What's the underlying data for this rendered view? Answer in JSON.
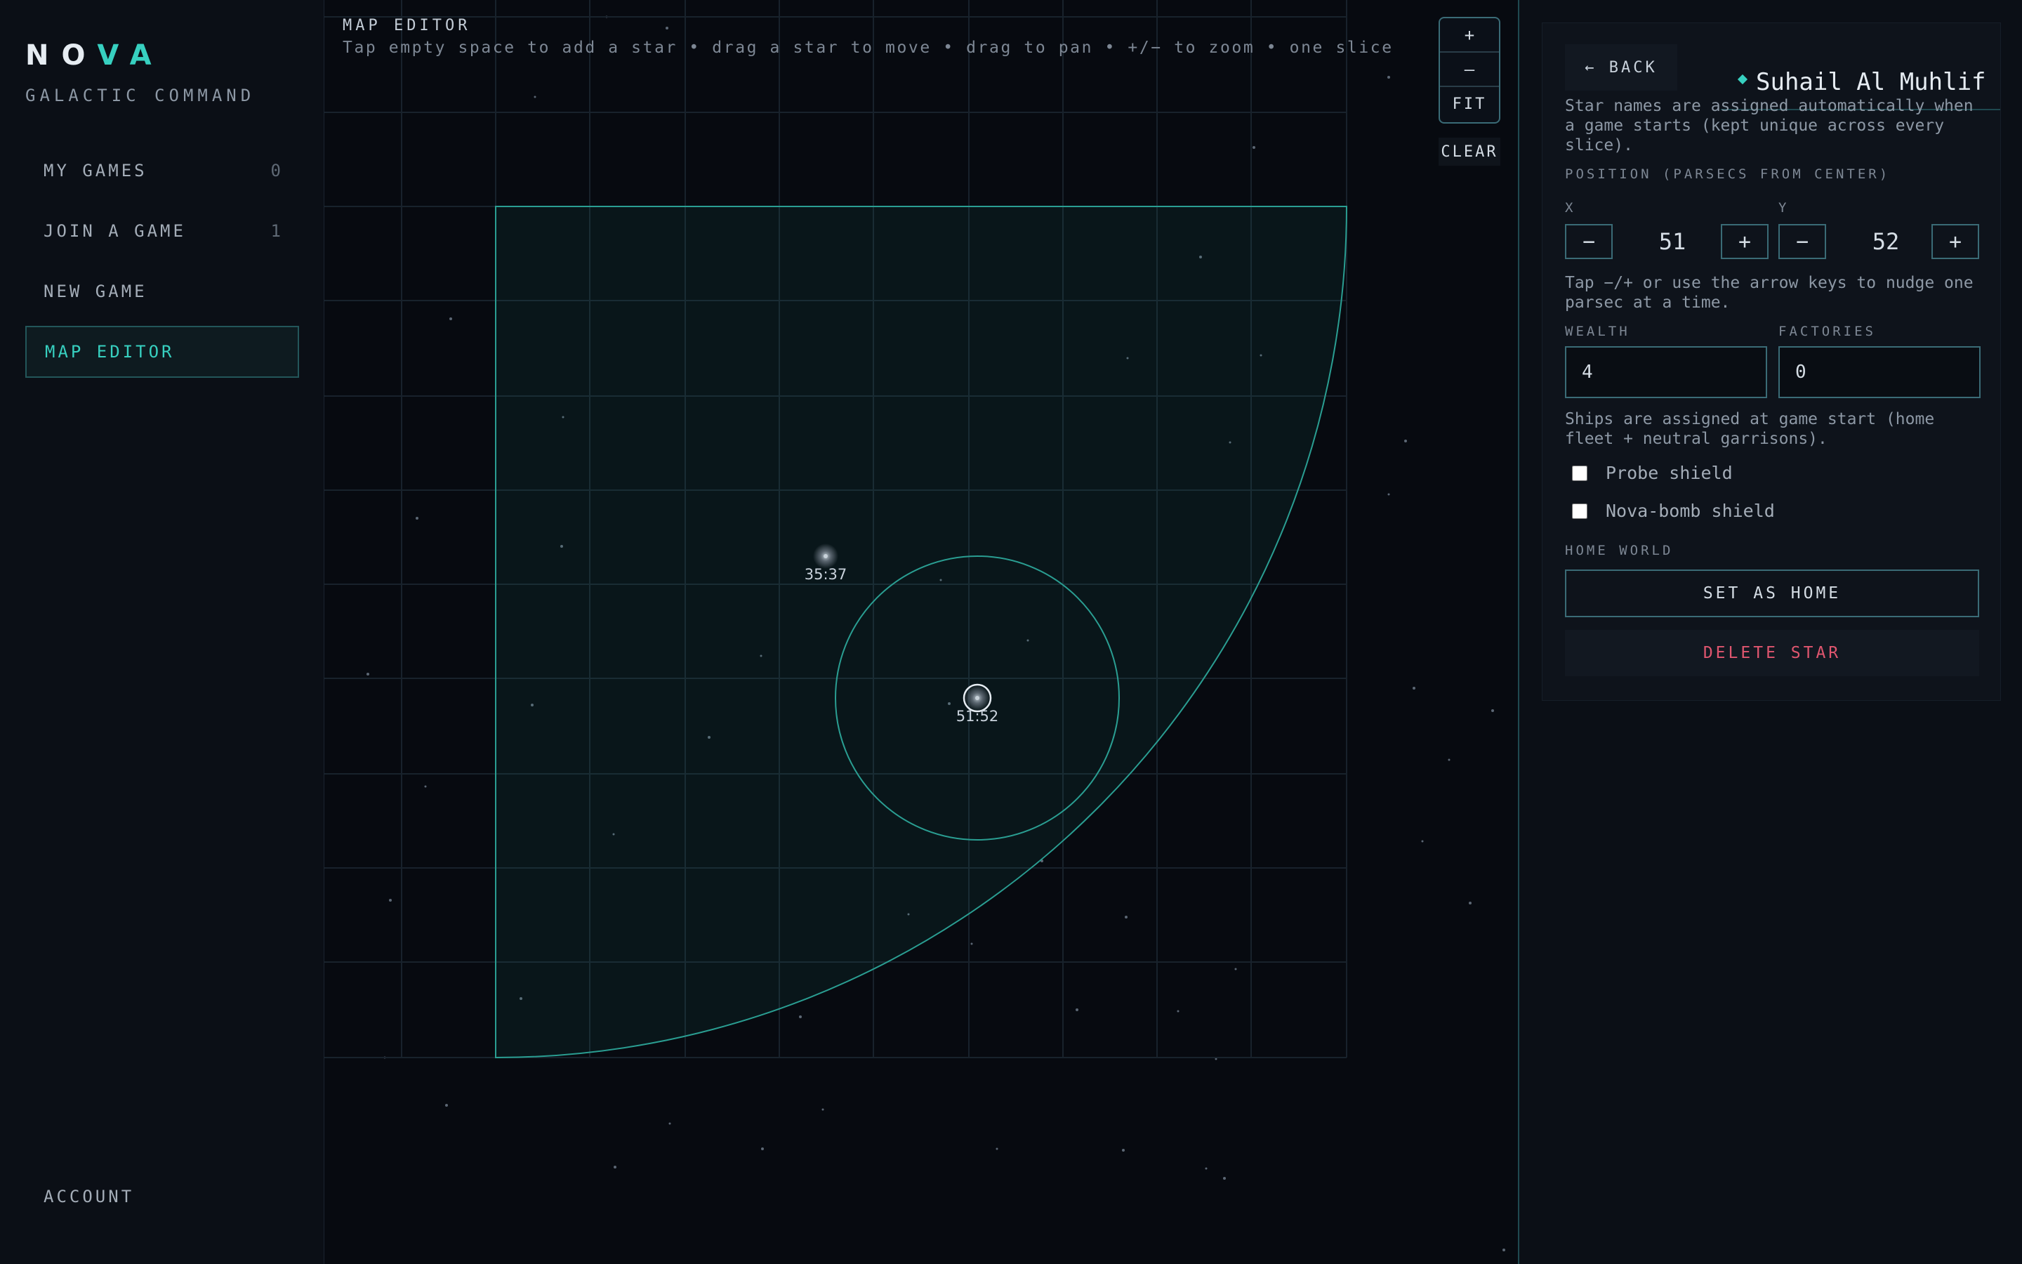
{
  "app": {
    "logo_part1": "NO",
    "logo_part2": "VA",
    "subtitle": "GALACTIC COMMAND"
  },
  "sidebar": {
    "items": [
      {
        "label": "MY GAMES",
        "count": "0"
      },
      {
        "label": "JOIN A GAME",
        "count": "1"
      },
      {
        "label": "NEW GAME",
        "count": ""
      },
      {
        "label": "MAP EDITOR",
        "count": ""
      }
    ],
    "active": "MAP EDITOR",
    "account_label": "ACCOUNT"
  },
  "map": {
    "title": "MAP EDITOR",
    "hint": "Tap empty space to add a star • drag a star to move • drag to pan • +/− to zoom • one slice",
    "zoom_in_label": "+",
    "zoom_out_label": "–",
    "fit_label": "FIT",
    "clear_label": "CLEAR",
    "stars": [
      {
        "label": "35:37",
        "selected": false
      },
      {
        "label": "51:52",
        "selected": true
      }
    ]
  },
  "panel": {
    "back_label": "← BACK",
    "star_name": "Suhail Al Muhlif",
    "name_note": "Star names are assigned automatically when a game starts (kept unique across every slice).",
    "position_label": "POSITION (PARSECS FROM CENTER)",
    "x_label": "X",
    "y_label": "Y",
    "x_value": "51",
    "y_value": "52",
    "minus_label": "−",
    "plus_label": "+",
    "nudge_note": "Tap −/+ or use the arrow keys to nudge one parsec at a time.",
    "wealth_label": "WEALTH",
    "wealth_value": "4",
    "factories_label": "FACTORIES",
    "factories_value": "0",
    "ships_note": "Ships are assigned at game start (home fleet + neutral garrisons).",
    "probe_shield_label": "Probe shield",
    "novabomb_shield_label": "Nova-bomb shield",
    "home_world_label": "HOME WORLD",
    "set_home_label": "SET AS HOME",
    "delete_label": "DELETE STAR"
  },
  "colors": {
    "accent": "#37d0c0",
    "danger": "#e0566f",
    "background": "#0a0d13"
  }
}
